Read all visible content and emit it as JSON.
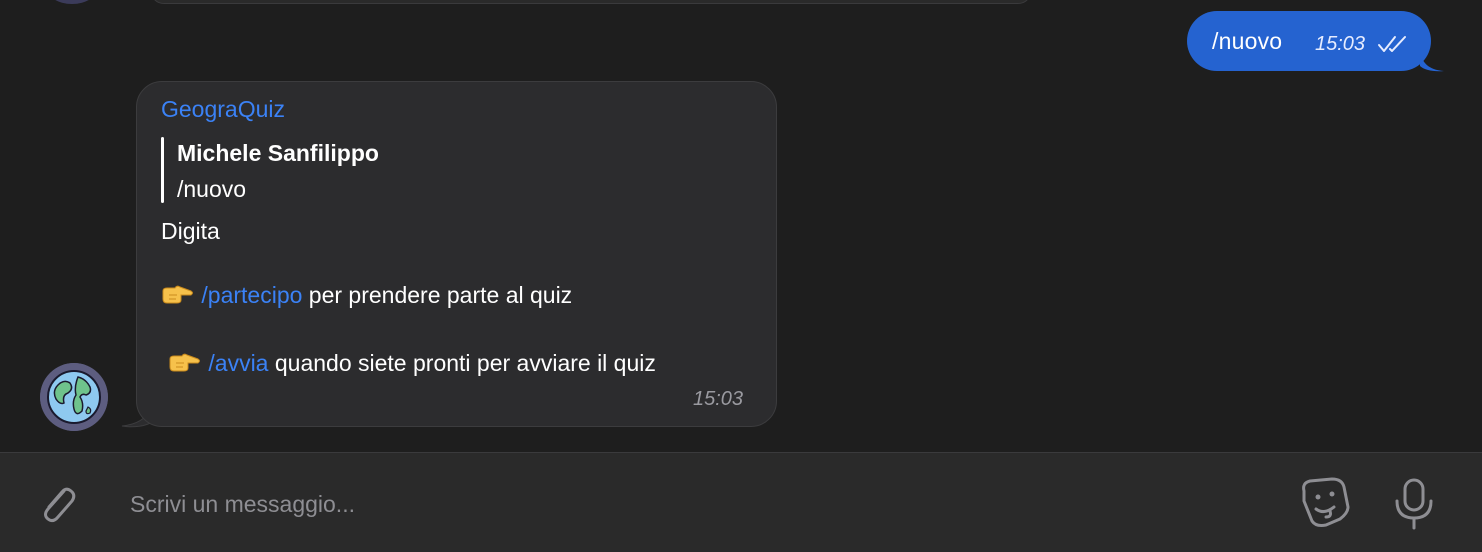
{
  "outgoing": {
    "text": "/nuovo",
    "time": "15:03",
    "status_icon": "double-check-icon",
    "bubble_color": "#2563d0"
  },
  "incoming": {
    "sender": "GeograQuiz",
    "quote": {
      "author": "Michele Sanfilippo",
      "text": "/nuovo"
    },
    "intro": "Digita",
    "line1": {
      "emoji_icon": "pointing-hand-icon",
      "command": "/partecipo",
      "text": " per prendere parte al quiz"
    },
    "line2": {
      "emoji_icon": "pointing-hand-icon",
      "command": "/avvia",
      "text": " quando siete pronti per avviare il quiz"
    },
    "time": "15:03",
    "avatar_icon": "globe-icon"
  },
  "composer": {
    "placeholder": "Scrivi un messaggio...",
    "value": "",
    "attach_icon": "paperclip-icon",
    "sticker_icon": "sticker-icon",
    "mic_icon": "microphone-icon"
  },
  "colors": {
    "accent": "#3b82f6",
    "background": "#1e1e1e",
    "bubble_incoming": "#2c2c2e"
  }
}
